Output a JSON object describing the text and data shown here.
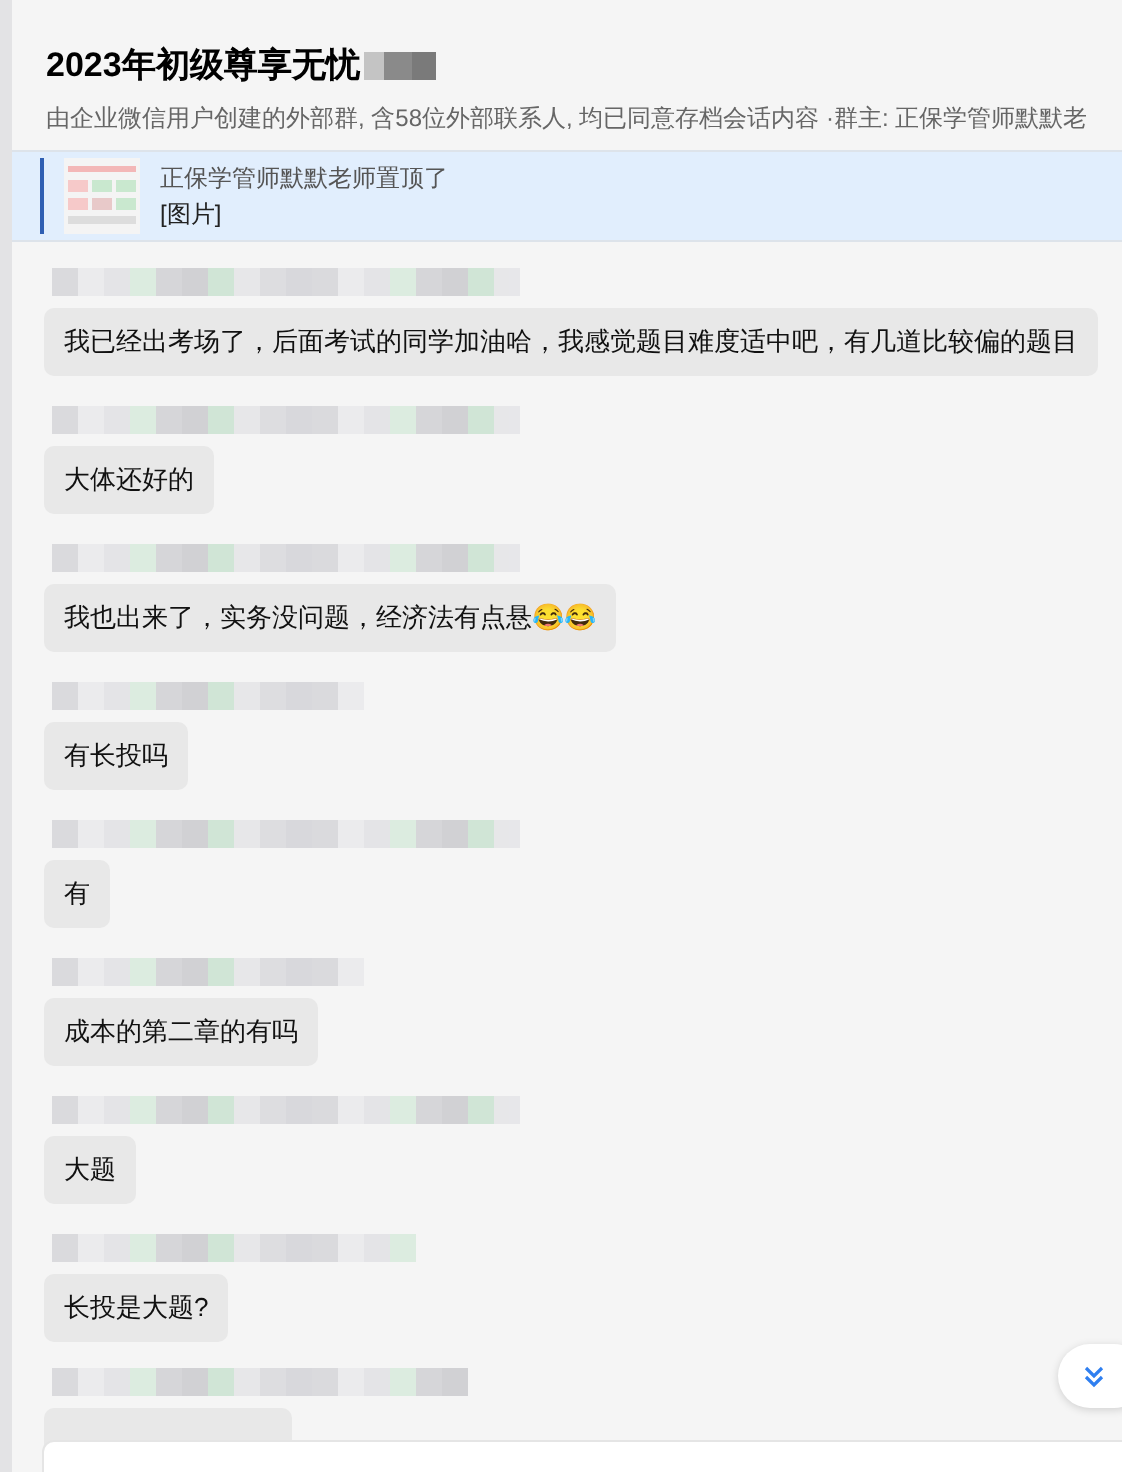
{
  "header": {
    "title": "2023年初级尊享无忧",
    "subtitle": "由企业微信用户创建的外部群, 含58位外部联系人, 均已同意存档会话内容 ·群主: 正保学管师默默老"
  },
  "pinned": {
    "notice": "正保学管师默默老师置顶了",
    "content": "[图片]"
  },
  "messages": [
    {
      "text": "我已经出考场了，后面考试的同学加油哈，我感觉题目难度适中吧，有几道比较偏的题目"
    },
    {
      "text": "大体还好的"
    },
    {
      "text": "我也出来了，实务没问题，经济法有点悬😂😂"
    },
    {
      "text": "有长投吗"
    },
    {
      "text": "有"
    },
    {
      "text": "成本的第二章的有吗"
    },
    {
      "text": "大题"
    },
    {
      "text": "长投是大题?"
    }
  ]
}
